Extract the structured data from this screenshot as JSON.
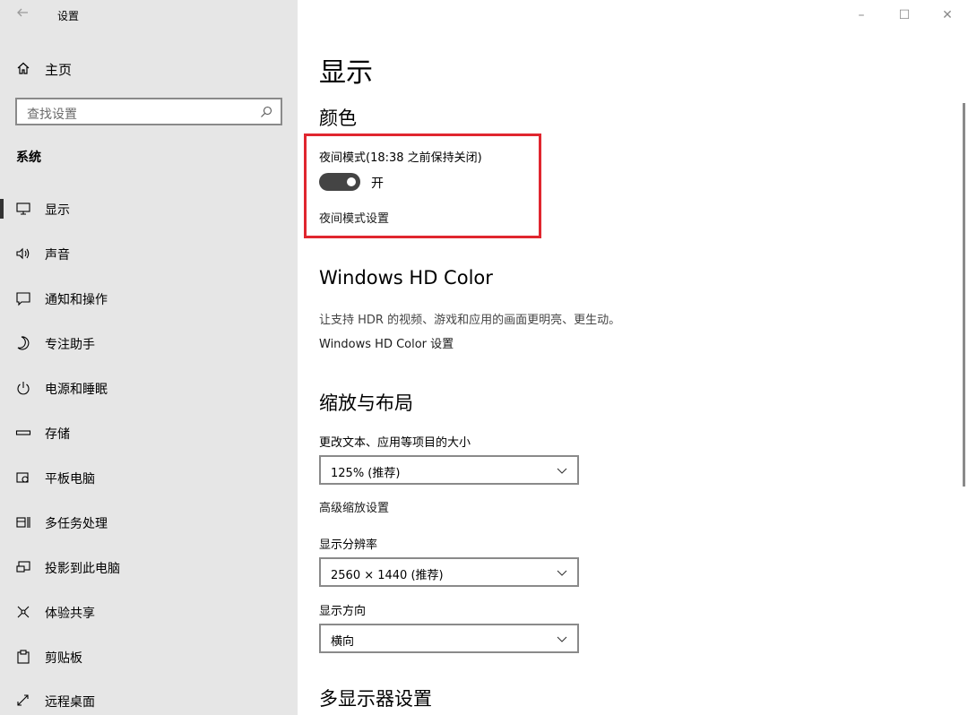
{
  "window": {
    "title": "设置",
    "controls": {
      "minimize": "–",
      "maximize": "☐",
      "close": "✕"
    }
  },
  "sidebar": {
    "home": "主页",
    "search_placeholder": "查找设置",
    "section": "系统",
    "items": [
      {
        "label": "显示",
        "icon": "monitor-icon",
        "active": true
      },
      {
        "label": "声音",
        "icon": "speaker-icon"
      },
      {
        "label": "通知和操作",
        "icon": "notification-icon"
      },
      {
        "label": "专注助手",
        "icon": "moon-icon"
      },
      {
        "label": "电源和睡眠",
        "icon": "power-icon"
      },
      {
        "label": "存储",
        "icon": "storage-icon"
      },
      {
        "label": "平板电脑",
        "icon": "tablet-icon"
      },
      {
        "label": "多任务处理",
        "icon": "multitask-icon"
      },
      {
        "label": "投影到此电脑",
        "icon": "project-icon"
      },
      {
        "label": "体验共享",
        "icon": "share-icon"
      },
      {
        "label": "剪贴板",
        "icon": "clipboard-icon"
      },
      {
        "label": "远程桌面",
        "icon": "remote-desktop-icon"
      }
    ]
  },
  "main": {
    "title": "显示",
    "color": {
      "heading": "颜色",
      "night_light_label": "夜间模式(18:38 之前保持关闭)",
      "toggle_state": "开",
      "night_light_settings": "夜间模式设置"
    },
    "hd_color": {
      "heading": "Windows HD Color",
      "description": "让支持 HDR 的视频、游戏和应用的画面更明亮、更生动。",
      "settings_link": "Windows HD Color 设置"
    },
    "scale_layout": {
      "heading": "缩放与布局",
      "scale_label": "更改文本、应用等项目的大小",
      "scale_value": "125% (推荐)",
      "advanced_link": "高级缩放设置",
      "resolution_label": "显示分辨率",
      "resolution_value": "2560 × 1440 (推荐)",
      "orientation_label": "显示方向",
      "orientation_value": "横向"
    },
    "multi_display": {
      "heading": "多显示器设置"
    }
  },
  "colors": {
    "sidebar_bg": "#e6e6e6",
    "highlight_border": "#e0262f",
    "toggle_bg": "#444444"
  }
}
